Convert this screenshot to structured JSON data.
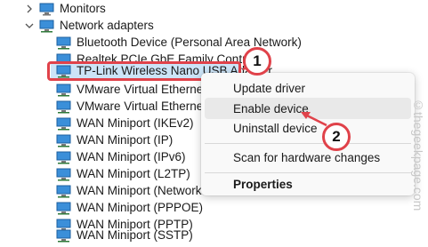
{
  "tree": {
    "monitors_label": "Monitors",
    "network_adapters_label": "Network adapters",
    "adapters": [
      "Bluetooth Device (Personal Area Network)",
      "Realtek PCIe GbE Family Controller",
      "TP-Link Wireless Nano USB Adapter",
      "VMware Virtual Ethernet Ad",
      "VMware Virtual Ethernet Ad",
      "WAN Miniport (IKEv2)",
      "WAN Miniport (IP)",
      "WAN Miniport (IPv6)",
      "WAN Miniport (L2TP)",
      "WAN Miniport (Network M",
      "WAN Miniport (PPPOE)",
      "WAN Miniport (PPTP)",
      "WAN Miniport (SSTP)"
    ]
  },
  "context_menu": {
    "update_driver": "Update driver",
    "enable_device": "Enable device",
    "uninstall_device": "Uninstall device",
    "scan_hardware": "Scan for hardware changes",
    "properties": "Properties"
  },
  "annotations": {
    "step1": "1",
    "step2": "2",
    "accent": "#e0424a"
  },
  "watermark": "©thegeekpage.com"
}
